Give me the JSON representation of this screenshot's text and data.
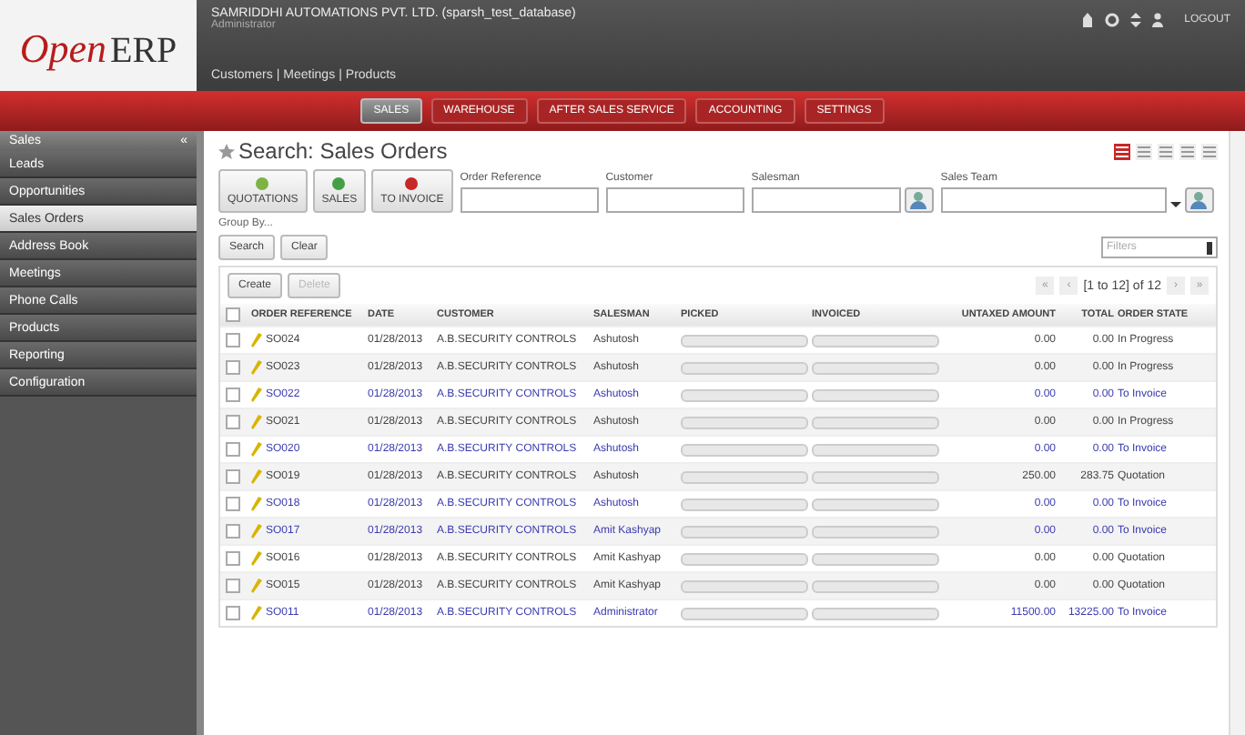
{
  "logo": {
    "left": "Open",
    "right": "ERP"
  },
  "company": {
    "name": "SAMRIDDHI AUTOMATIONS PVT. LTD. (sparsh_test_database)",
    "user": "Administrator"
  },
  "shortcuts": [
    "Customers",
    "Meetings",
    "Products"
  ],
  "shortcut_separators": [
    "|",
    "|"
  ],
  "top_right": {
    "logout": "LOGOUT"
  },
  "main_menu": [
    {
      "label": "SALES",
      "selected": true
    },
    {
      "label": "WAREHOUSE",
      "selected": false
    },
    {
      "label": "AFTER SALES SERVICE",
      "selected": false
    },
    {
      "label": "ACCOUNTING",
      "selected": false
    },
    {
      "label": "SETTINGS",
      "selected": false
    }
  ],
  "sidebar": {
    "title": "Sales",
    "collapse": "«",
    "items": [
      {
        "label": "Leads",
        "selected": false
      },
      {
        "label": "Opportunities",
        "selected": false
      },
      {
        "label": "Sales Orders",
        "selected": true
      },
      {
        "label": "Address Book",
        "selected": false
      },
      {
        "label": "Meetings",
        "selected": false
      },
      {
        "label": "Phone Calls",
        "selected": false
      },
      {
        "label": "Products",
        "selected": false
      },
      {
        "label": "Reporting",
        "selected": false
      },
      {
        "label": "Configuration",
        "selected": false
      }
    ]
  },
  "page_title": "Search: Sales Orders",
  "views": [
    {
      "selected": true
    },
    {
      "selected": false
    },
    {
      "selected": false
    },
    {
      "selected": false
    },
    {
      "selected": false
    }
  ],
  "filters": [
    {
      "label": "QUOTATIONS",
      "kind": "quote",
      "selected": false
    },
    {
      "label": "SALES",
      "kind": "sales",
      "selected": false
    },
    {
      "label": "TO INVOICE",
      "kind": "invoice",
      "selected": false
    }
  ],
  "search_fields": [
    {
      "label": "Order Reference",
      "kind": "text"
    },
    {
      "label": "Customer",
      "kind": "text"
    },
    {
      "label": "Salesman",
      "kind": "person"
    },
    {
      "label": "Sales Team",
      "kind": "select"
    }
  ],
  "group_by": "Group By...",
  "buttons": {
    "search": "Search",
    "clear": "Clear",
    "create": "Create",
    "delete": "Delete"
  },
  "filter_select": {
    "placeholder": "Filters"
  },
  "pager": {
    "first": "«",
    "prev": "‹",
    "text": "[1 to 12] of 12",
    "next": "›",
    "last": "»"
  },
  "table": {
    "select_all": {
      "checked": false
    },
    "columns": [
      "ORDER REFERENCE",
      "DATE",
      "CUSTOMER",
      "SALESMAN",
      "PICKED",
      "INVOICED",
      "UNTAXED AMOUNT",
      "TOTAL",
      "ORDER STATE"
    ],
    "rows": [
      {
        "kind": "plain",
        "checked": false,
        "cells": [
          "SO024",
          "01/28/2013",
          "A.B.SECURITY CONTROLS",
          "Ashutosh",
          "",
          "",
          "0.00",
          "0.00",
          "In Progress"
        ]
      },
      {
        "kind": "plain",
        "checked": false,
        "cells": [
          "SO023",
          "01/28/2013",
          "A.B.SECURITY CONTROLS",
          "Ashutosh",
          "",
          "",
          "0.00",
          "0.00",
          "In Progress"
        ]
      },
      {
        "kind": "highlight",
        "checked": false,
        "cells": [
          "SO022",
          "01/28/2013",
          "A.B.SECURITY CONTROLS",
          "Ashutosh",
          "",
          "",
          "0.00",
          "0.00",
          "To Invoice"
        ]
      },
      {
        "kind": "plain",
        "checked": false,
        "cells": [
          "SO021",
          "01/28/2013",
          "A.B.SECURITY CONTROLS",
          "Ashutosh",
          "",
          "",
          "0.00",
          "0.00",
          "In Progress"
        ]
      },
      {
        "kind": "highlight",
        "checked": false,
        "cells": [
          "SO020",
          "01/28/2013",
          "A.B.SECURITY CONTROLS",
          "Ashutosh",
          "",
          "",
          "0.00",
          "0.00",
          "To Invoice"
        ]
      },
      {
        "kind": "plain",
        "checked": false,
        "cells": [
          "SO019",
          "01/28/2013",
          "A.B.SECURITY CONTROLS",
          "Ashutosh",
          "",
          "",
          "250.00",
          "283.75",
          "Quotation"
        ]
      },
      {
        "kind": "highlight",
        "checked": false,
        "cells": [
          "SO018",
          "01/28/2013",
          "A.B.SECURITY CONTROLS",
          "Ashutosh",
          "",
          "",
          "0.00",
          "0.00",
          "To Invoice"
        ]
      },
      {
        "kind": "highlight",
        "checked": false,
        "cells": [
          "SO017",
          "01/28/2013",
          "A.B.SECURITY CONTROLS",
          "Amit Kashyap",
          "",
          "",
          "0.00",
          "0.00",
          "To Invoice"
        ]
      },
      {
        "kind": "plain",
        "checked": false,
        "cells": [
          "SO016",
          "01/28/2013",
          "A.B.SECURITY CONTROLS",
          "Amit Kashyap",
          "",
          "",
          "0.00",
          "0.00",
          "Quotation"
        ]
      },
      {
        "kind": "plain",
        "checked": false,
        "cells": [
          "SO015",
          "01/28/2013",
          "A.B.SECURITY CONTROLS",
          "Amit Kashyap",
          "",
          "",
          "0.00",
          "0.00",
          "Quotation"
        ]
      },
      {
        "kind": "highlight",
        "checked": false,
        "cells": [
          "SO011",
          "01/28/2013",
          "A.B.SECURITY CONTROLS",
          "Administrator",
          "",
          "",
          "11500.00",
          "13225.00",
          "To Invoice"
        ]
      }
    ]
  }
}
